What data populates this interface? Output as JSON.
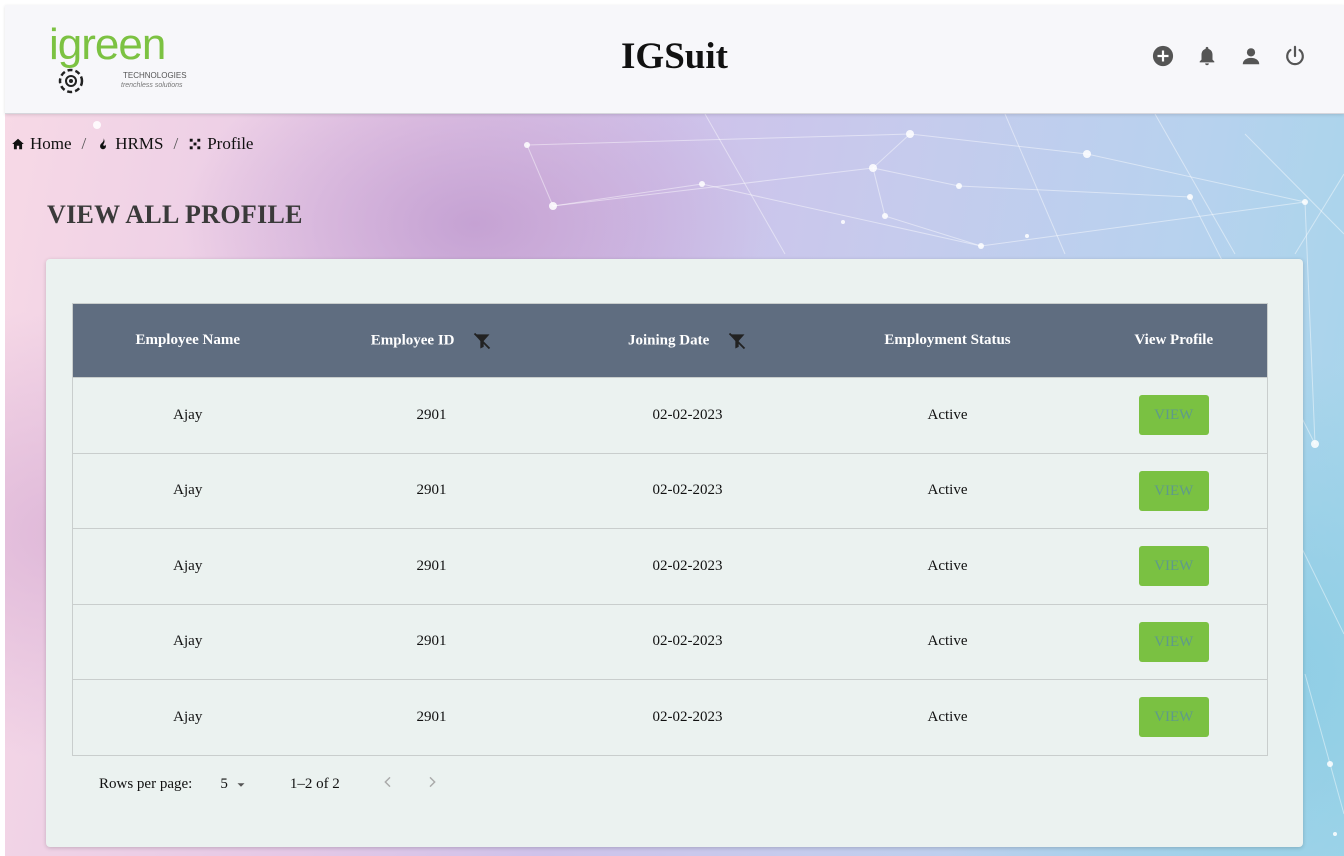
{
  "header": {
    "logo_word": "igreen",
    "logo_sub1": "TECHNOLOGIES",
    "logo_sub2": "trenchless solutions",
    "app_title": "IGSuit"
  },
  "breadcrumb": [
    {
      "label": "Home",
      "icon": "home-icon"
    },
    {
      "label": "HRMS",
      "icon": "fire-icon"
    },
    {
      "label": "Profile",
      "icon": "grid-dots-icon"
    }
  ],
  "page_title": "VIEW ALL PROFILE",
  "table": {
    "columns": [
      "Employee Name",
      "Employee ID",
      "Joining Date",
      "Employment Status",
      "View Profile"
    ],
    "rows": [
      {
        "name": "Ajay",
        "id": "2901",
        "date": "02-02-2023",
        "status": "Active",
        "action": "VIEW"
      },
      {
        "name": "Ajay",
        "id": "2901",
        "date": "02-02-2023",
        "status": "Active",
        "action": "VIEW"
      },
      {
        "name": "Ajay",
        "id": "2901",
        "date": "02-02-2023",
        "status": "Active",
        "action": "VIEW"
      },
      {
        "name": "Ajay",
        "id": "2901",
        "date": "02-02-2023",
        "status": "Active",
        "action": "VIEW"
      },
      {
        "name": "Ajay",
        "id": "2901",
        "date": "02-02-2023",
        "status": "Active",
        "action": "VIEW"
      }
    ]
  },
  "pagination": {
    "rows_per_page_label": "Rows per page:",
    "rows_per_page_value": "5",
    "range": "1–2 of 2"
  },
  "colors": {
    "brand_green": "#7ac142",
    "table_header": "#5f6d80",
    "card_bg": "#ebf2f0"
  }
}
